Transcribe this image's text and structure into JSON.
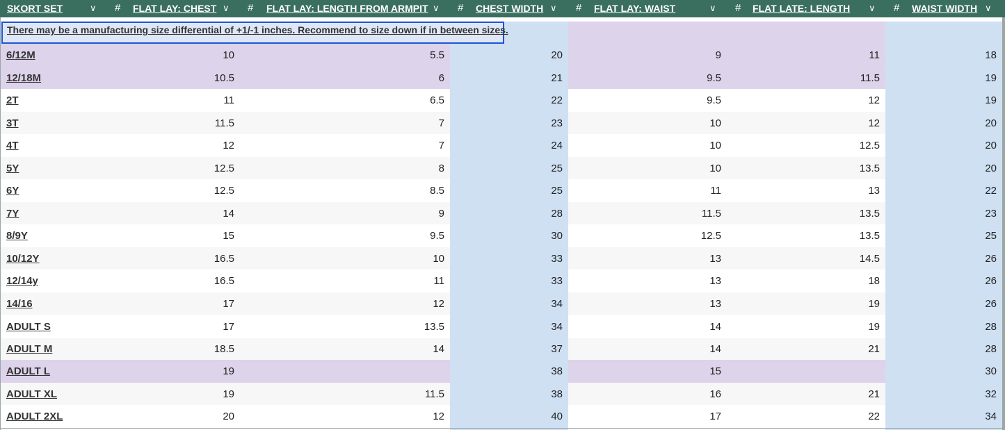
{
  "columns": [
    {
      "label": "SKORT SET",
      "hash": ""
    },
    {
      "label": "FLAT LAY: CHEST",
      "hash": "#"
    },
    {
      "label": "FLAT LAY: LENGTH FROM ARMPIT",
      "hash": "#"
    },
    {
      "label": "CHEST WIDTH",
      "hash": "#"
    },
    {
      "label": "FLAT LAY: WAIST",
      "hash": "#"
    },
    {
      "label": "FLAT LATE: LENGTH",
      "hash": "#"
    },
    {
      "label": "WAIST WIDTH",
      "hash": "#"
    }
  ],
  "dropdown_icon": "chevron-down-icon",
  "note": "There may be a manufacturing size differential of +1/-1 inches. Recommend to size down if in between sizes.",
  "colors": {
    "header_bg": "#3a6e5e",
    "light_blue": "#cfe0f3",
    "lavender": "#ddd3ea",
    "zebra": "#f7f7f7",
    "selection": "#1a56d6"
  },
  "rows": [
    {
      "size": "6/12M",
      "values": [
        "10",
        "5.5",
        "20",
        "9",
        "11",
        "18"
      ],
      "highlight": "lavender"
    },
    {
      "size": "12/18M",
      "values": [
        "10.5",
        "6",
        "21",
        "9.5",
        "11.5",
        "19"
      ],
      "highlight": "lavender"
    },
    {
      "size": "2T",
      "values": [
        "11",
        "6.5",
        "22",
        "9.5",
        "12",
        "19"
      ],
      "highlight": ""
    },
    {
      "size": "3T",
      "values": [
        "11.5",
        "7",
        "23",
        "10",
        "12",
        "20"
      ],
      "highlight": ""
    },
    {
      "size": "4T",
      "values": [
        "12",
        "7",
        "24",
        "10",
        "12.5",
        "20"
      ],
      "highlight": ""
    },
    {
      "size": "5Y",
      "values": [
        "12.5",
        "8",
        "25",
        "10",
        "13.5",
        "20"
      ],
      "highlight": ""
    },
    {
      "size": "6Y",
      "values": [
        "12.5",
        "8.5",
        "25",
        "11",
        "13",
        "22"
      ],
      "highlight": ""
    },
    {
      "size": "7Y",
      "values": [
        "14",
        "9",
        "28",
        "11.5",
        "13.5",
        "23"
      ],
      "highlight": ""
    },
    {
      "size": "8/9Y",
      "values": [
        "15",
        "9.5",
        "30",
        "12.5",
        "13.5",
        "25"
      ],
      "highlight": ""
    },
    {
      "size": "10/12Y",
      "values": [
        "16.5",
        "10",
        "33",
        "13",
        "14.5",
        "26"
      ],
      "highlight": ""
    },
    {
      "size": "12/14y",
      "values": [
        "16.5",
        "11",
        "33",
        "13",
        "18",
        "26"
      ],
      "highlight": ""
    },
    {
      "size": "14/16",
      "values": [
        "17",
        "12",
        "34",
        "13",
        "19",
        "26"
      ],
      "highlight": ""
    },
    {
      "size": "ADULT S",
      "values": [
        "17",
        "13.5",
        "34",
        "14",
        "19",
        "28"
      ],
      "highlight": ""
    },
    {
      "size": "ADULT M",
      "values": [
        "18.5",
        "14",
        "37",
        "14",
        "21",
        "28"
      ],
      "highlight": ""
    },
    {
      "size": "ADULT L",
      "values": [
        "19",
        "",
        "38",
        "15",
        "",
        "30"
      ],
      "highlight": "lavender"
    },
    {
      "size": "ADULT XL",
      "values": [
        "19",
        "11.5",
        "38",
        "16",
        "21",
        "32"
      ],
      "highlight": ""
    },
    {
      "size": "ADULT 2XL",
      "values": [
        "20",
        "12",
        "40",
        "17",
        "22",
        "34"
      ],
      "highlight": ""
    }
  ]
}
